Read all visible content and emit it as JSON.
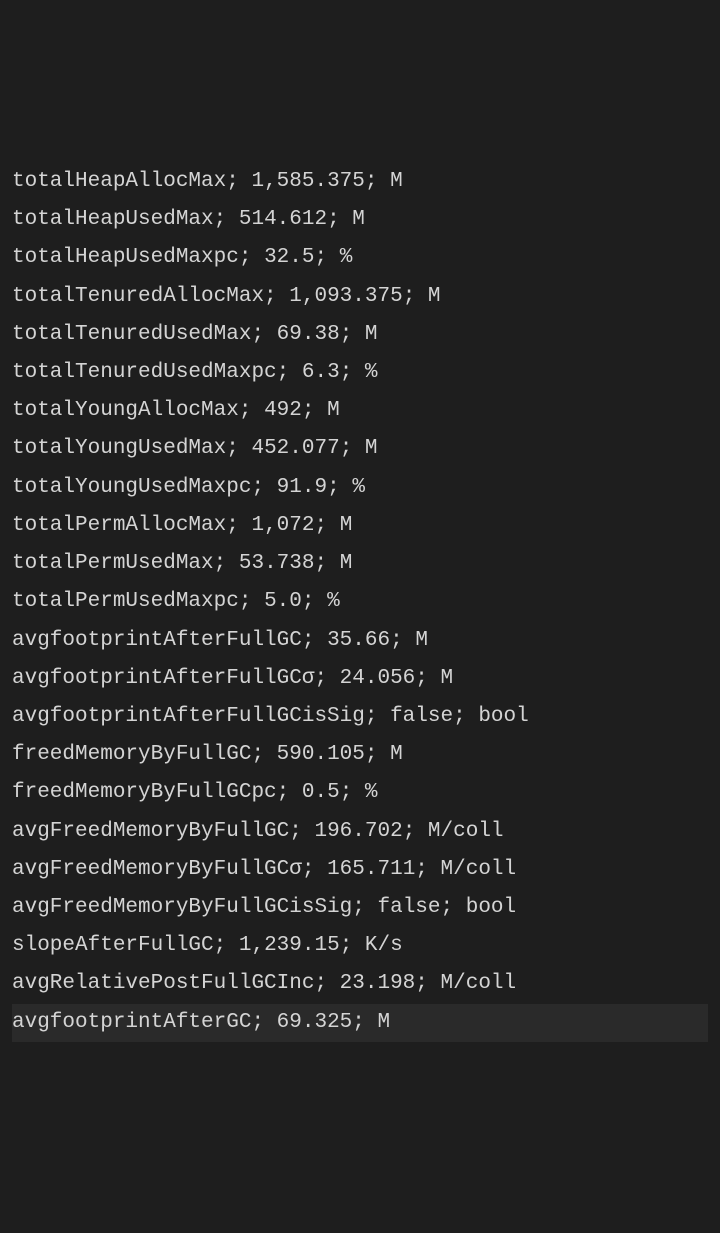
{
  "metrics": [
    {
      "name": "totalHeapAllocMax",
      "value": "1,585.375",
      "unit": "M",
      "highlight": false
    },
    {
      "name": "totalHeapUsedMax",
      "value": "514.612",
      "unit": "M",
      "highlight": false
    },
    {
      "name": "totalHeapUsedMaxpc",
      "value": "32.5",
      "unit": "%",
      "highlight": false
    },
    {
      "name": "totalTenuredAllocMax",
      "value": "1,093.375",
      "unit": "M",
      "highlight": false
    },
    {
      "name": "totalTenuredUsedMax",
      "value": "69.38",
      "unit": "M",
      "highlight": false
    },
    {
      "name": "totalTenuredUsedMaxpc",
      "value": "6.3",
      "unit": "%",
      "highlight": false
    },
    {
      "name": "totalYoungAllocMax",
      "value": "492",
      "unit": "M",
      "highlight": false
    },
    {
      "name": "totalYoungUsedMax",
      "value": "452.077",
      "unit": "M",
      "highlight": false
    },
    {
      "name": "totalYoungUsedMaxpc",
      "value": "91.9",
      "unit": "%",
      "highlight": false
    },
    {
      "name": "totalPermAllocMax",
      "value": "1,072",
      "unit": "M",
      "highlight": false
    },
    {
      "name": "totalPermUsedMax",
      "value": "53.738",
      "unit": "M",
      "highlight": false
    },
    {
      "name": "totalPermUsedMaxpc",
      "value": "5.0",
      "unit": "%",
      "highlight": false
    },
    {
      "name": "avgfootprintAfterFullGC",
      "value": "35.66",
      "unit": "M",
      "highlight": false
    },
    {
      "name": "avgfootprintAfterFullGCσ",
      "value": "24.056",
      "unit": "M",
      "highlight": false
    },
    {
      "name": "avgfootprintAfterFullGCisSig",
      "value": "false",
      "unit": "bool",
      "highlight": false
    },
    {
      "name": "freedMemoryByFullGC",
      "value": "590.105",
      "unit": "M",
      "highlight": false
    },
    {
      "name": "freedMemoryByFullGCpc",
      "value": "0.5",
      "unit": "%",
      "highlight": false
    },
    {
      "name": "avgFreedMemoryByFullGC",
      "value": "196.702",
      "unit": "M/coll",
      "highlight": false
    },
    {
      "name": "avgFreedMemoryByFullGCσ",
      "value": "165.711",
      "unit": "M/coll",
      "highlight": false
    },
    {
      "name": "avgFreedMemoryByFullGCisSig",
      "value": "false",
      "unit": "bool",
      "highlight": false
    },
    {
      "name": "slopeAfterFullGC",
      "value": "1,239.15",
      "unit": "K/s",
      "highlight": false
    },
    {
      "name": "avgRelativePostFullGCInc",
      "value": "23.198",
      "unit": "M/coll",
      "highlight": false
    },
    {
      "name": "avgfootprintAfterGC",
      "value": "69.325",
      "unit": "M",
      "highlight": true
    }
  ]
}
